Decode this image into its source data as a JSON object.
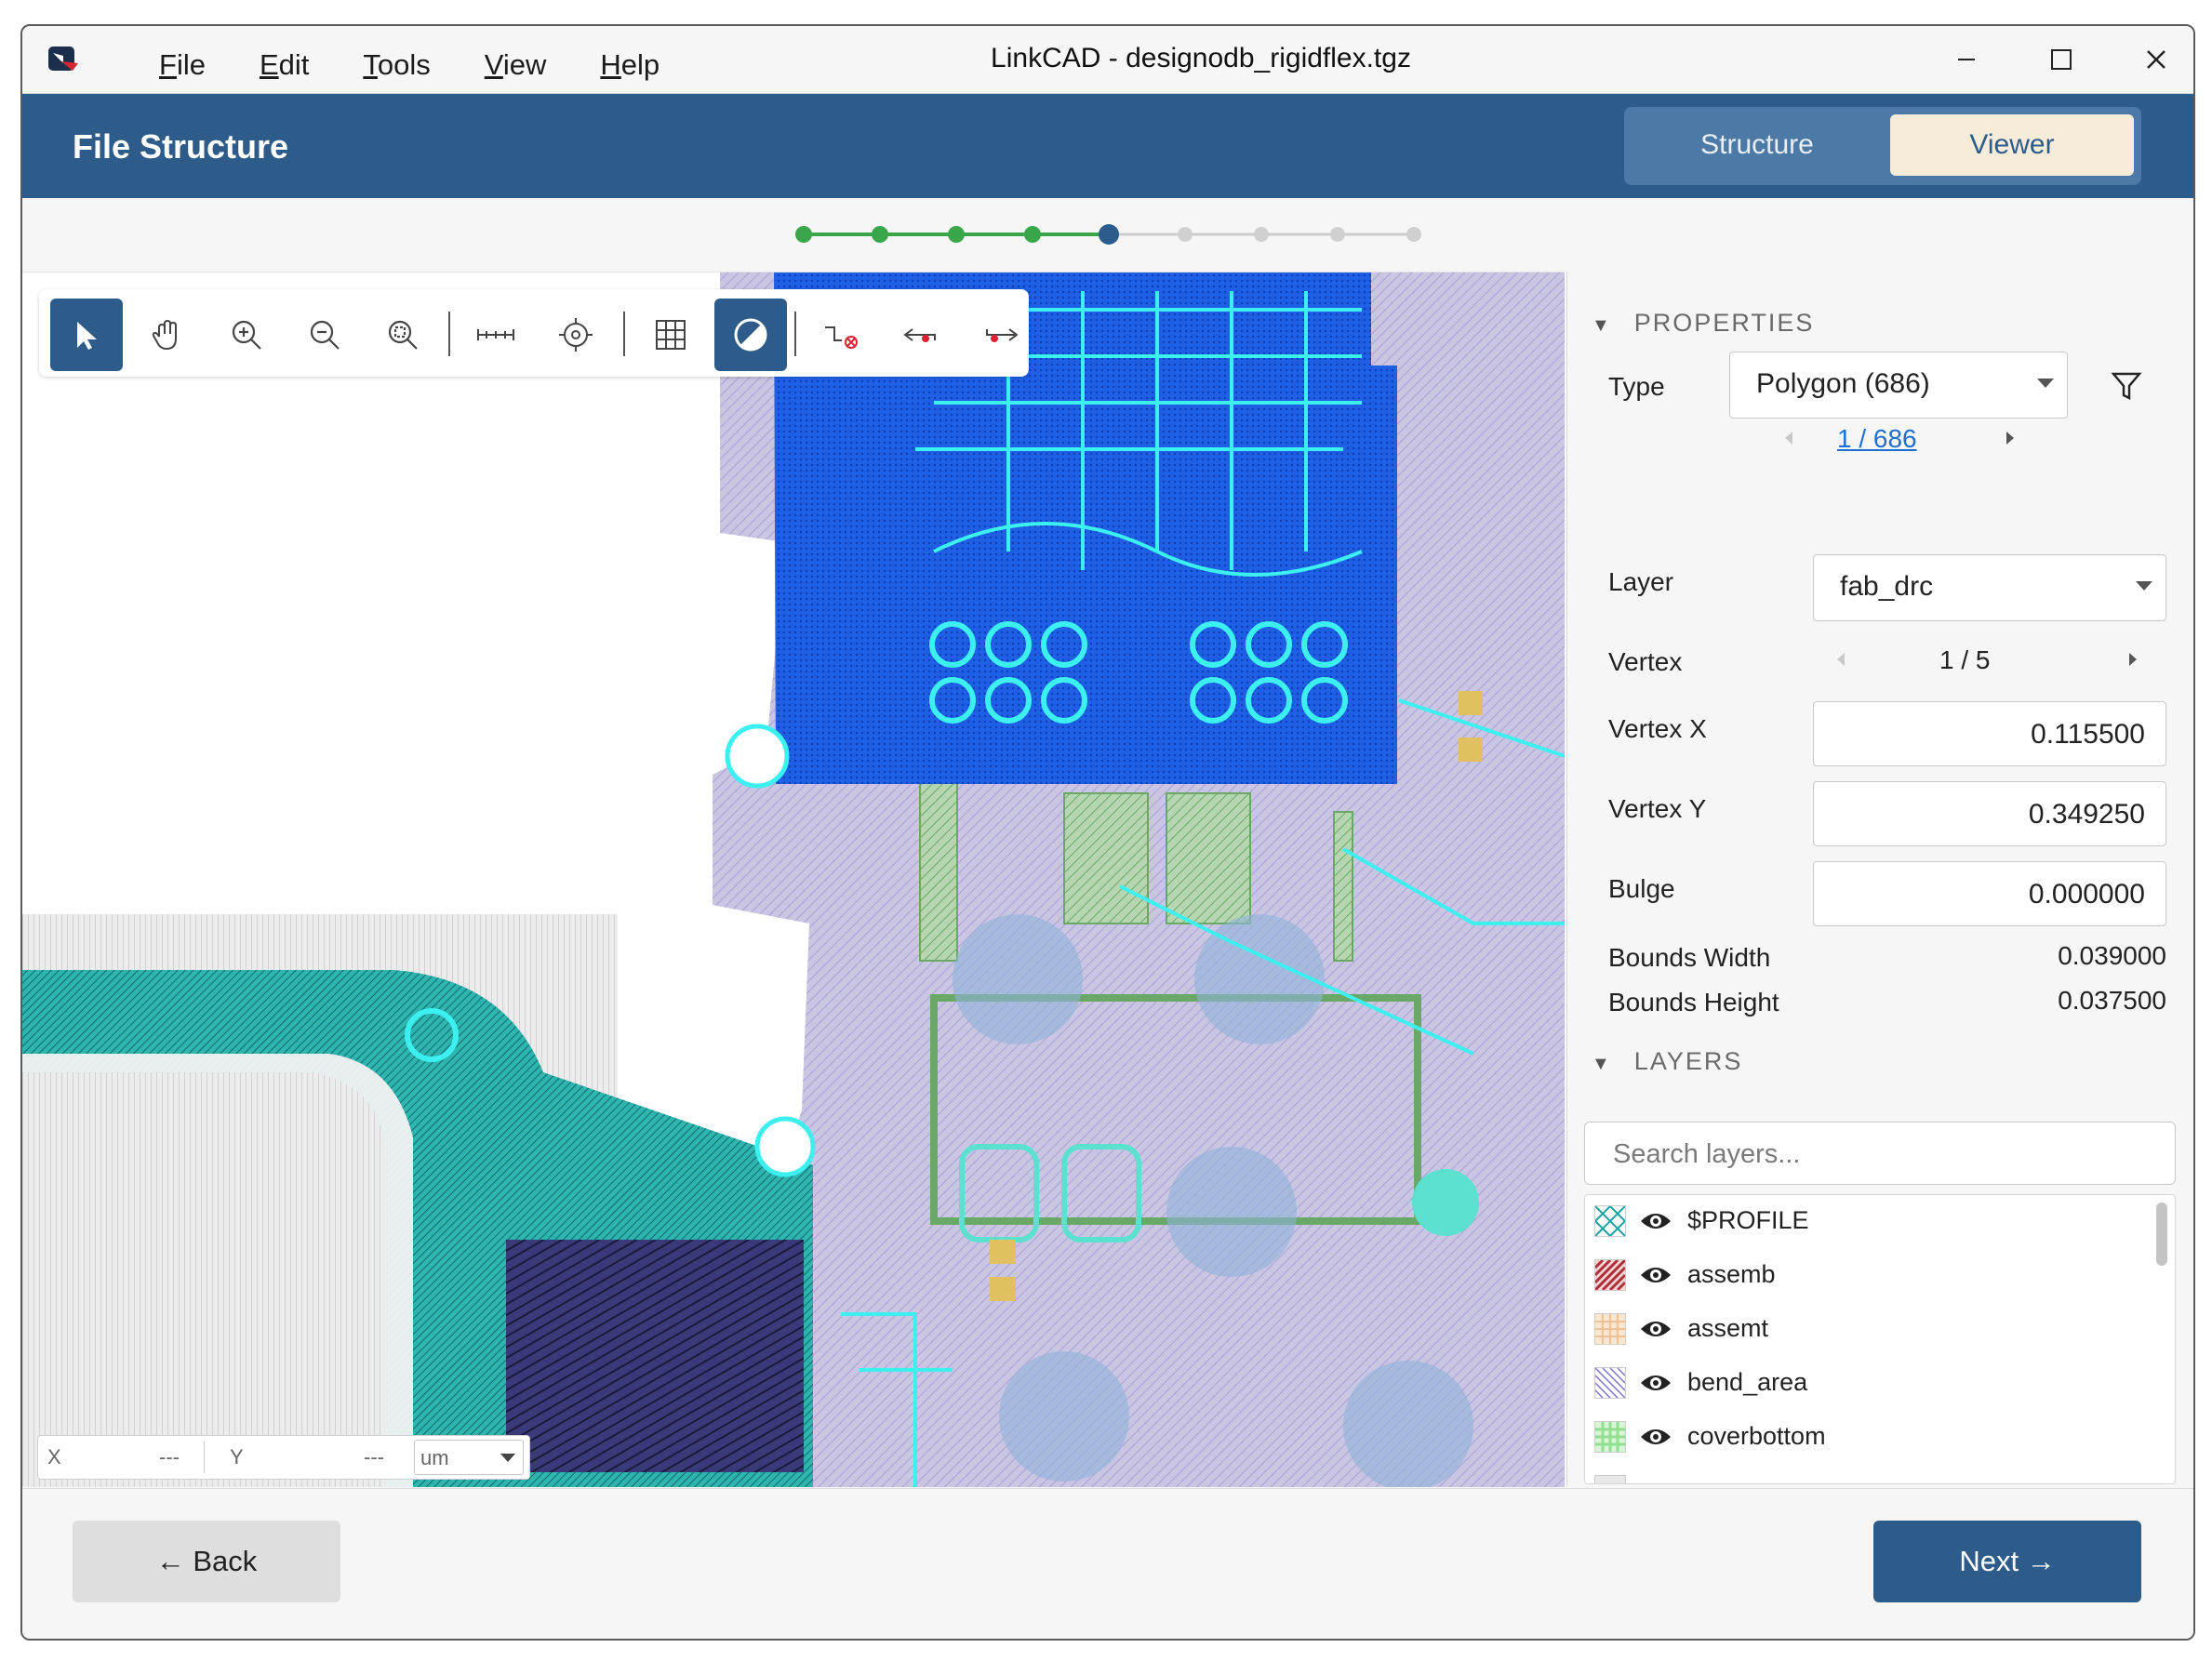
{
  "window": {
    "title": "LinkCAD - designodb_rigidflex.tgz",
    "menu": [
      {
        "label": "File",
        "key": "F",
        "rest": "ile"
      },
      {
        "label": "Edit",
        "key": "E",
        "rest": "dit"
      },
      {
        "label": "Tools",
        "key": "T",
        "rest": "ools"
      },
      {
        "label": "View",
        "key": "V",
        "rest": "iew"
      },
      {
        "label": "Help",
        "key": "H",
        "rest": "elp"
      }
    ],
    "controls": {
      "minimize": "–",
      "maximize": "☐",
      "close": "✕"
    }
  },
  "header": {
    "title": "File Structure",
    "tabs": {
      "structure": "Structure",
      "viewer": "Viewer"
    },
    "active_tab": "Viewer"
  },
  "stepper": {
    "total_steps": 9,
    "current_step": 5
  },
  "toolbar": {
    "tools": [
      "select-icon",
      "pan-hand-icon",
      "zoom-in-icon",
      "zoom-out-icon",
      "zoom-fit-icon",
      "measure-ruler-icon",
      "crosshair-icon",
      "grid-icon",
      "contrast-icon",
      "deselect-icon",
      "previous-icon",
      "next-icon"
    ],
    "active": [
      "select-icon",
      "contrast-icon"
    ]
  },
  "coords": {
    "x_label": "X",
    "x_value": "---",
    "y_label": "Y",
    "y_value": "---",
    "unit": "um"
  },
  "properties": {
    "section_title": "PROPERTIES",
    "type_label": "Type",
    "type_value": "Polygon (686)",
    "pager": "1 / 686",
    "layer_label": "Layer",
    "layer_value": "fab_drc",
    "vertex_label": "Vertex",
    "vertex_value": "1 / 5",
    "vertex_x_label": "Vertex X",
    "vertex_x_value": "0.115500",
    "vertex_y_label": "Vertex Y",
    "vertex_y_value": "0.349250",
    "bulge_label": "Bulge",
    "bulge_value": "0.000000",
    "bounds_width_label": "Bounds Width",
    "bounds_width_value": "0.039000",
    "bounds_height_label": "Bounds Height",
    "bounds_height_value": "0.037500"
  },
  "layers": {
    "section_title": "LAYERS",
    "search_placeholder": "Search layers...",
    "items": [
      {
        "name": "$PROFILE",
        "color": "#1aa3a3"
      },
      {
        "name": "assemb",
        "color": "#b0303a"
      },
      {
        "name": "assemt",
        "color": "#f0c090"
      },
      {
        "name": "bend_area",
        "color": "#7a74cc"
      },
      {
        "name": "coverbottom",
        "color": "#8fe08f"
      },
      {
        "name": "",
        "color": "#d0d0d0"
      }
    ]
  },
  "footer": {
    "back": "← Back",
    "next": "Next →"
  },
  "colors": {
    "brand": "#2e5c8a",
    "step_done": "#3aa64a",
    "step_pending": "#cccccc",
    "link": "#1f6fd0"
  }
}
